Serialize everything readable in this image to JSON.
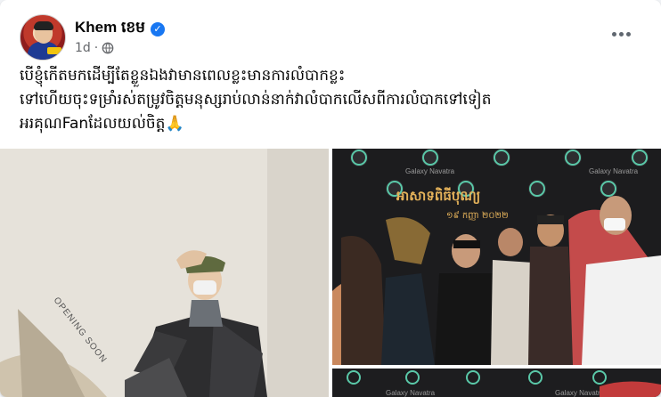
{
  "post": {
    "author": "Khem ខេម",
    "time": "1d",
    "dot": "·",
    "verified_glyph": "✓",
    "caption_lines": [
      "បើខ្ញុំកើតមកដើម្បីតែខ្លួនឯងវាមានពេលខ្លះមានការលំបាកខ្លះ",
      "ទៅហើយចុះទម្រាំរស់តម្រូវចិត្តមនុស្សរាប់លាន់នាក់វាលំបាកលើសពីការលំបាកទៅទៀត",
      "អរគុណFanដែលយល់ចិត្ត🙏"
    ],
    "icons": {
      "avatar": "profile-avatar",
      "verified": "verified-badge-icon",
      "audience": "globe-icon",
      "more": "more-options-icon"
    }
  },
  "photos": {
    "left": {
      "sign": "OPENING SOON"
    },
    "right_top": {
      "backdrop_text": "Galaxy Navatra",
      "event_title": "អាសាទពិធីបុណ្យ",
      "date": "១៩ កញ្ញា ២០២២"
    },
    "right_bottom": {
      "backdrop_text": "Galaxy Navatra"
    }
  },
  "colors": {
    "brand_blue": "#1877f2",
    "text_primary": "#050505",
    "text_secondary": "#65676b"
  }
}
